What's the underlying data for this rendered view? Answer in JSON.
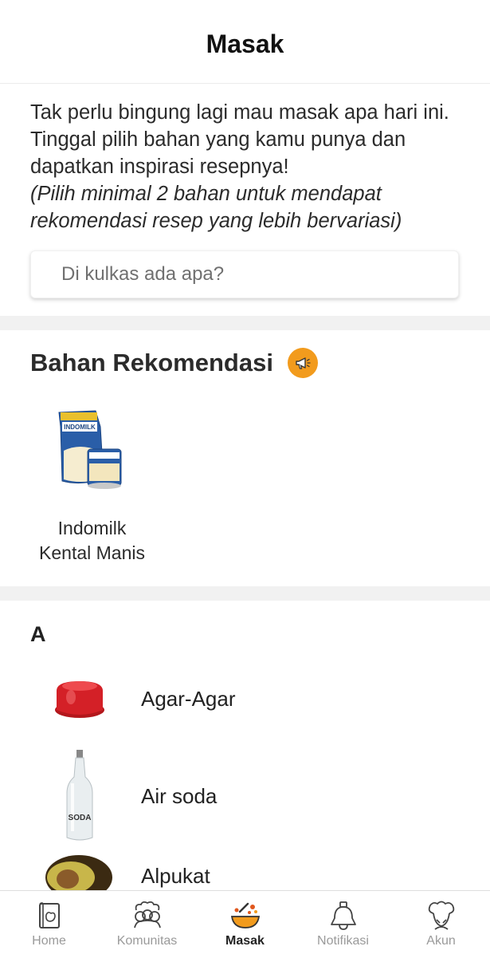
{
  "header": {
    "title": "Masak"
  },
  "intro": {
    "text": "Tak perlu bingung lagi mau masak apa hari ini. Tinggal pilih bahan yang kamu punya dan dapatkan inspirasi resepnya!",
    "note": "(Pilih minimal 2 bahan untuk mendapat rekomendasi resep yang lebih bervariasi)"
  },
  "search": {
    "placeholder": "Di kulkas ada apa?"
  },
  "recommended": {
    "title": "Bahan Rekomendasi",
    "icon": "megaphone-icon",
    "items": [
      {
        "line1": "Indomilk",
        "line2": "Kental Manis",
        "image": "indomilk-product-image",
        "pack_text": "INDOMILK"
      }
    ]
  },
  "list": {
    "letter": "A",
    "items": [
      {
        "name": "Agar-Agar",
        "image": "agar-agar-image"
      },
      {
        "name": "Air soda",
        "image": "soda-bottle-image",
        "bottle_text": "SODA"
      },
      {
        "name": "Alpukat",
        "image": "avocado-image"
      }
    ]
  },
  "nav": {
    "active": "Masak",
    "tabs": [
      {
        "label": "Home",
        "icon": "home-icon"
      },
      {
        "label": "Komunitas",
        "icon": "community-icon"
      },
      {
        "label": "Masak",
        "icon": "wok-icon"
      },
      {
        "label": "Notifikasi",
        "icon": "bell-icon"
      },
      {
        "label": "Akun",
        "icon": "chef-hat-icon"
      }
    ]
  },
  "colors": {
    "accent": "#f29b1d",
    "separator": "#f1f1f1",
    "inactive": "#9a9a9a"
  }
}
